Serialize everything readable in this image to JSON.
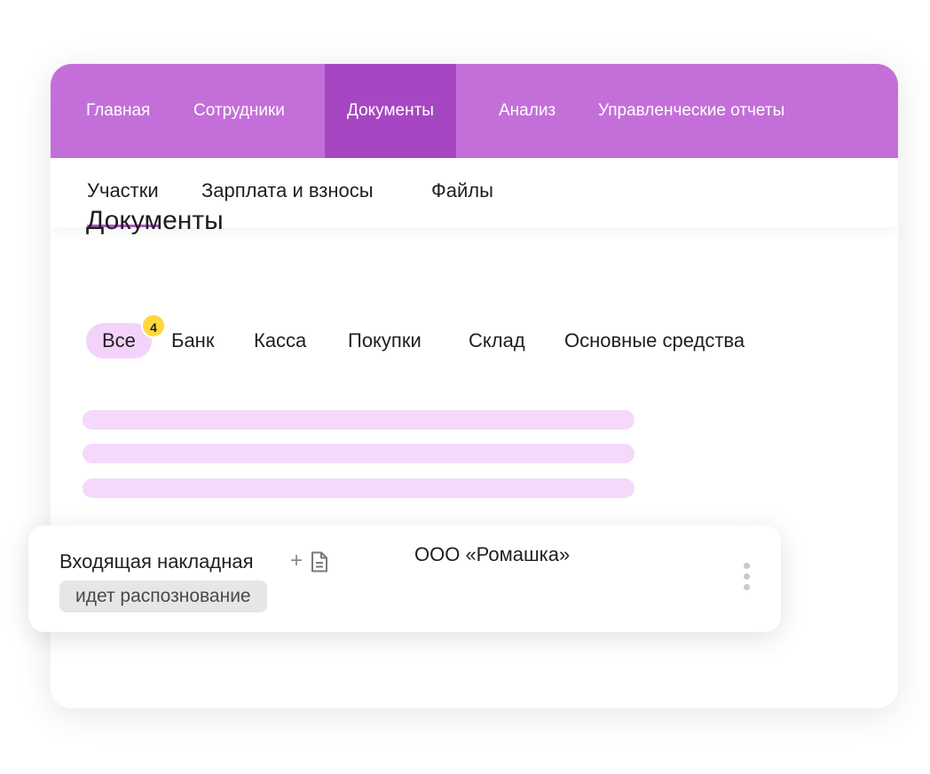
{
  "topnav": {
    "items": [
      {
        "label": "Главная"
      },
      {
        "label": "Сотрудники"
      },
      {
        "label": "Документы",
        "active": true
      },
      {
        "label": "Анализ"
      },
      {
        "label": "Управленческие отчеты"
      }
    ]
  },
  "subnav": {
    "items": [
      {
        "label": "Участки",
        "active": true
      },
      {
        "label": "Зарплата и взносы"
      },
      {
        "label": "Файлы"
      }
    ]
  },
  "page": {
    "title": "Документы"
  },
  "filters": {
    "badge_count": "4",
    "items": [
      {
        "label": "Все",
        "active": true
      },
      {
        "label": "Банк"
      },
      {
        "label": "Касса"
      },
      {
        "label": "Покупки"
      },
      {
        "label": "Склад"
      },
      {
        "label": "Основные средства"
      }
    ]
  },
  "card": {
    "title": "Входящая накладная",
    "plus": "+",
    "company": "ООО «Ромашка»",
    "status": "идет распознование",
    "icon": "document-icon",
    "menu_icon": "kebab-menu-icon"
  },
  "colors": {
    "topnav_bg": "#c46fd9",
    "topnav_active_bg": "#a646c3",
    "accent": "#b553d0",
    "chip_active_bg": "#f4d3fb",
    "badge_bg": "#ffd83a",
    "skeleton": "#f4d9fb"
  }
}
